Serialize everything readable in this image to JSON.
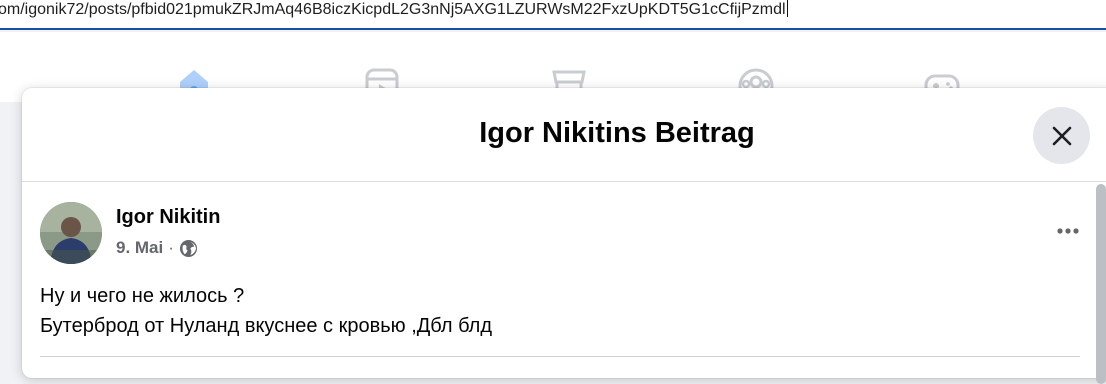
{
  "browser": {
    "url": "om/igonik72/posts/pfbid021pmukZRJmAq46B8iczKicpdL2G3nNj5AXG1LZURWsM22FxzUpKDT5G1cCfijPzmdl"
  },
  "nav": {
    "icons": [
      "home-icon",
      "video-icon",
      "marketplace-icon",
      "groups-icon",
      "gaming-icon"
    ]
  },
  "modal": {
    "title": "Igor Nikitins Beitrag",
    "close_icon": "close-icon"
  },
  "post": {
    "author": "Igor Nikitin",
    "date": "9. Mai",
    "separator": "·",
    "audience_icon": "globe-icon",
    "more_icon": "more-options-icon",
    "text_lines": [
      "Ну и чего не жилось ?",
      "Бутерброд от Нуланд вкуснее с кровью ,Дбл блд"
    ]
  },
  "colors": {
    "accent": "#1877f2",
    "icon_gray": "#c9ccd1",
    "secondary_text": "#65676b",
    "close_bg": "#e4e6eb"
  }
}
